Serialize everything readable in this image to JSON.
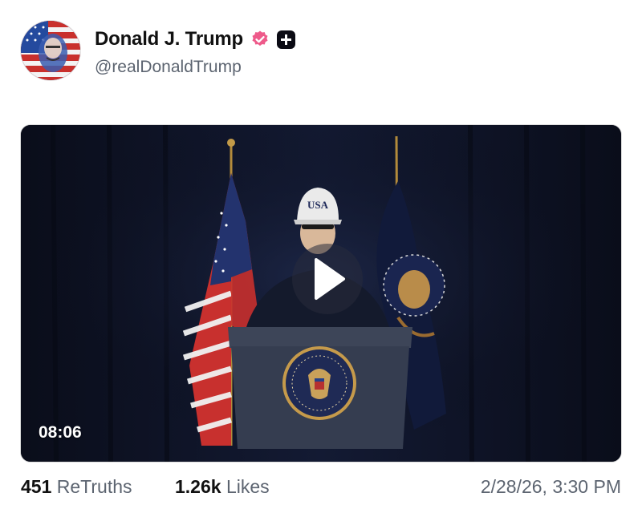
{
  "post": {
    "author": {
      "display_name": "Donald J. Trump",
      "handle": "@realDonaldTrump",
      "avatar_icon": "flag-portrait-avatar",
      "verified_icon": "verified-badge-icon",
      "verified_color": "#ee5a8a",
      "plus_badge_icon": "plus-badge-icon"
    },
    "video": {
      "duration": "08:06",
      "play_icon": "play-icon",
      "hat_text": "USA",
      "seal_text": "SEAL OF THE PRESIDENT OF THE UNITED STATES"
    },
    "stats": {
      "retruths_count": "451",
      "retruths_label": "ReTruths",
      "likes_count": "1.26k",
      "likes_label": "Likes"
    },
    "timestamp": "2/28/26, 3:30 PM"
  },
  "colors": {
    "background": "#ffffff",
    "secondary_text": "#5c6470",
    "video_background": "#0c0f1d"
  }
}
